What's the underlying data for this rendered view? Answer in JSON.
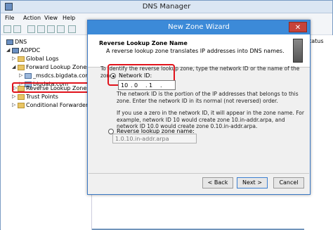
{
  "app_title": "DNS Manager",
  "menu": [
    "File",
    "Action",
    "View",
    "Help"
  ],
  "tree": {
    "root": "DNS",
    "server": "ADPDC",
    "items": [
      "Global Logs",
      "Forward Lookup Zones",
      "_msdcs.bigdata.com",
      "bigdata.com",
      "Reverse Lookup Zones",
      "Trust Points",
      "Conditional Forwarders"
    ]
  },
  "right_pane": {
    "header": "Status"
  },
  "dialog": {
    "title": "New Zone Wizard",
    "close_label": "✕",
    "header_title": "Reverse Lookup Zone Name",
    "header_desc": "A reverse lookup zone translates IP addresses into DNS names.",
    "instruction": "To identify the reverse lookup zone, type the network ID or the name of the zone.",
    "network_id_label": "Network ID:",
    "network_id": [
      "10",
      "0",
      "1",
      ""
    ],
    "network_id_help": "The network ID is the portion of the IP addresses that belongs to this zone. Enter the network ID in its normal (not reversed) order.",
    "zero_help": "If you use a zero in the network ID, it will appear in the zone name. For example, network ID 10 would create zone 10.in-addr.arpa, and network ID 10.0 would create zone 0.10.in-addr.arpa.",
    "zone_name_label": "Reverse lookup zone name:",
    "zone_name_value": "1.0.10.in-addr.arpa",
    "back_button": "< Back",
    "next_button": "Next >",
    "cancel_button": "Cancel"
  }
}
